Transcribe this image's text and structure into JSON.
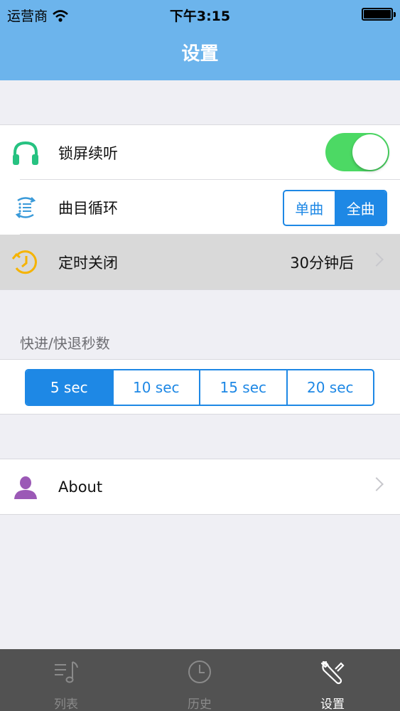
{
  "status_bar": {
    "carrier": "运营商",
    "time": "下午3:15"
  },
  "nav": {
    "title": "设置"
  },
  "settings": {
    "lock_screen": {
      "label": "锁屏续听",
      "toggle_on": true,
      "icon": "headphones-icon"
    },
    "loop": {
      "label": "曲目循环",
      "options": [
        "单曲",
        "全曲"
      ],
      "selected": "全曲",
      "icon": "repeat-list-icon"
    },
    "timer": {
      "label": "定时关闭",
      "value": "30分钟后",
      "icon": "timer-clock-icon"
    }
  },
  "seek": {
    "header": "快进/快退秒数",
    "options": [
      "5 sec",
      "10 sec",
      "15 sec",
      "20 sec"
    ],
    "selected": "5 sec"
  },
  "about": {
    "label": "About",
    "icon": "person-icon"
  },
  "tabbar": {
    "tabs": [
      {
        "label": "列表",
        "icon": "music-list-icon",
        "active": false
      },
      {
        "label": "历史",
        "icon": "clock-icon",
        "active": false
      },
      {
        "label": "设置",
        "icon": "wrench-icon",
        "active": true
      }
    ]
  },
  "colors": {
    "nav_bg": "#6cb4ec",
    "accent_blue": "#1e88e5",
    "toggle_green": "#4cd964",
    "headphones_green": "#26c281",
    "timer_yellow": "#f5b301",
    "person_purple": "#9b59b6",
    "tabbar_bg": "#525252"
  }
}
